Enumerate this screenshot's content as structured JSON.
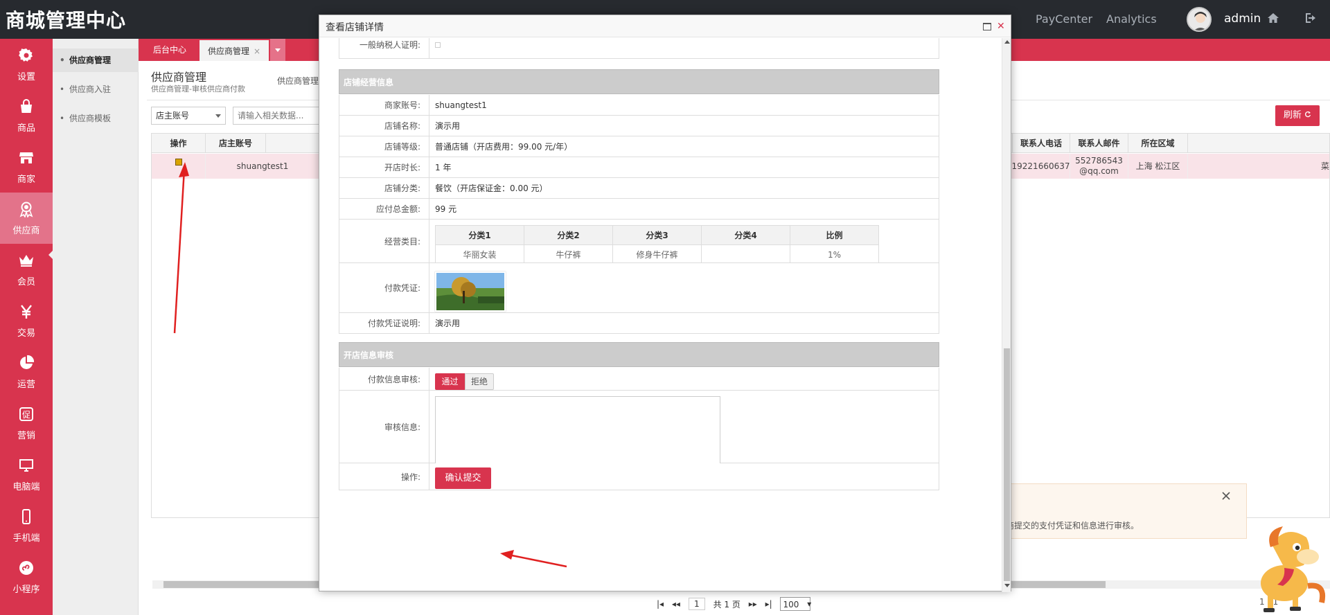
{
  "header": {
    "brand": "商城管理中心",
    "links": [
      "PayCenter",
      "Analytics"
    ],
    "user": "admin"
  },
  "leftnav": [
    {
      "label": "设置",
      "icon": "gear-icon"
    },
    {
      "label": "商品",
      "icon": "bag-icon"
    },
    {
      "label": "商家",
      "icon": "store-icon"
    },
    {
      "label": "供应商",
      "icon": "medal-icon",
      "active": true
    },
    {
      "label": "会员",
      "icon": "crown-icon"
    },
    {
      "label": "交易",
      "icon": "yen-icon"
    },
    {
      "label": "运营",
      "icon": "pie-icon"
    },
    {
      "label": "营销",
      "icon": "promo-icon"
    },
    {
      "label": "电脑端",
      "icon": "monitor-icon"
    },
    {
      "label": "手机端",
      "icon": "phone-icon"
    },
    {
      "label": "小程序",
      "icon": "miniapp-icon"
    }
  ],
  "subnav": [
    "供应商管理",
    "供应商入驻",
    "供应商模板"
  ],
  "tabs": {
    "home": "后台中心",
    "current": "供应商管理"
  },
  "page": {
    "title": "供应商管理",
    "subtitle": "供应商管理-审核供应商付款",
    "subtitle2": "供应商管理",
    "filter": "店主账号",
    "search_placeholder": "请输入相关数据...",
    "refresh": "刷新"
  },
  "grid": {
    "headers_left": [
      "操作",
      "店主账号"
    ],
    "headers_right": [
      "联系人电话",
      "联系人邮件",
      "所在区域"
    ],
    "row": {
      "account": "shuangtest1",
      "phone": "19221660637",
      "email": "552786543@qq.com",
      "region": "上海 松江区",
      "extra": "菜"
    }
  },
  "notice": {
    "text": "商提交的支付凭证和信息进行审核。"
  },
  "pager": {
    "page": "1",
    "total": "共 1 页",
    "size": "100",
    "range": "1 - 1"
  },
  "modal": {
    "title": "查看店铺详情",
    "partial_label": "一般纳税人证明:",
    "section1": "店铺经营信息",
    "fields": [
      {
        "label": "商家账号:",
        "value": "shuangtest1"
      },
      {
        "label": "店铺名称:",
        "value": "演示用"
      },
      {
        "label": "店铺等级:",
        "value": "普通店铺（开店费用：99.00 元/年）"
      },
      {
        "label": "开店时长:",
        "value": "1 年"
      },
      {
        "label": "店铺分类:",
        "value": "餐饮（开店保证金：0.00 元）"
      },
      {
        "label": "应付总金额:",
        "value": "99 元"
      }
    ],
    "category_label": "经营类目:",
    "category_headers": [
      "分类1",
      "分类2",
      "分类3",
      "分类4",
      "比例"
    ],
    "category_row": [
      "华丽女装",
      "牛仔裤",
      "修身牛仔裤",
      "",
      "1%"
    ],
    "voucher_label": "付款凭证:",
    "voucher_note_label": "付款凭证说明:",
    "voucher_note": "演示用",
    "section2": "开店信息审核",
    "audit_label": "付款信息审核:",
    "pass": "通过",
    "reject": "拒绝",
    "review_label": "审核信息:",
    "action_label": "操作:",
    "submit": "确认提交"
  },
  "colors": {
    "accent": "#d8344e",
    "topbar": "#272a2f"
  }
}
